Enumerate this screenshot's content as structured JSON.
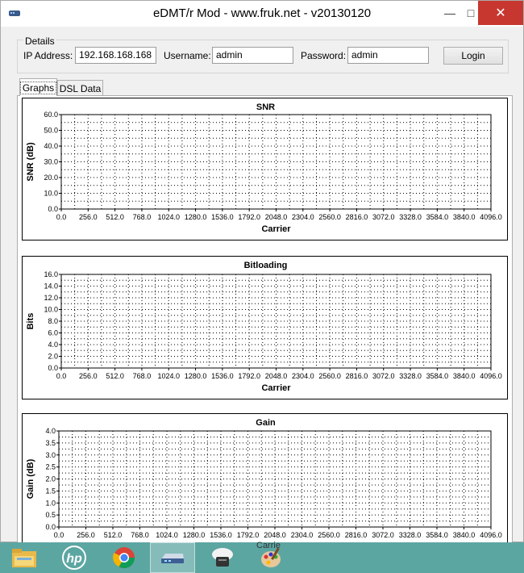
{
  "window": {
    "title": "eDMT/r Mod - www.fruk.net - v20130120",
    "minimize": "—",
    "maximize": "□",
    "close": "✕"
  },
  "details": {
    "legend": "Details",
    "ip_label": "IP Address:",
    "ip_value": "192.168.168.168",
    "username_label": "Username:",
    "username_value": "admin",
    "password_label": "Password:",
    "password_value": "admin",
    "login_label": "Login"
  },
  "tabs": [
    {
      "label": "Graphs",
      "selected": true
    },
    {
      "label": "DSL Data",
      "selected": false
    }
  ],
  "chart_data": [
    {
      "type": "scatter",
      "title": "SNR",
      "xlabel": "Carrier",
      "ylabel": "SNR (dB)",
      "xlim": [
        0,
        4096
      ],
      "ylim": [
        0,
        60
      ],
      "x_ticks": [
        "0.0",
        "256.0",
        "512.0",
        "768.0",
        "1024.0",
        "1280.0",
        "1536.0",
        "1792.0",
        "2048.0",
        "2304.0",
        "2560.0",
        "2816.0",
        "3072.0",
        "3328.0",
        "3584.0",
        "3840.0",
        "4096.0"
      ],
      "y_ticks": [
        "0.0",
        "10.0",
        "20.0",
        "30.0",
        "40.0",
        "50.0",
        "60.0"
      ],
      "grid": true,
      "series": []
    },
    {
      "type": "scatter",
      "title": "Bitloading",
      "xlabel": "Carrier",
      "ylabel": "Bits",
      "xlim": [
        0,
        4096
      ],
      "ylim": [
        0,
        16
      ],
      "x_ticks": [
        "0.0",
        "256.0",
        "512.0",
        "768.0",
        "1024.0",
        "1280.0",
        "1536.0",
        "1792.0",
        "2048.0",
        "2304.0",
        "2560.0",
        "2816.0",
        "3072.0",
        "3328.0",
        "3584.0",
        "3840.0",
        "4096.0"
      ],
      "y_ticks": [
        "0.0",
        "2.0",
        "4.0",
        "6.0",
        "8.0",
        "10.0",
        "12.0",
        "14.0",
        "16.0"
      ],
      "grid": true,
      "series": []
    },
    {
      "type": "scatter",
      "title": "Gain",
      "xlabel": "Carrier",
      "ylabel": "Gain (dB)",
      "xlim": [
        0,
        4096
      ],
      "ylim": [
        0,
        4
      ],
      "x_ticks": [
        "0.0",
        "256.0",
        "512.0",
        "768.0",
        "1024.0",
        "1280.0",
        "1536.0",
        "1792.0",
        "2048.0",
        "2304.0",
        "2560.0",
        "2816.0",
        "3072.0",
        "3328.0",
        "3584.0",
        "3840.0",
        "4096.0"
      ],
      "y_ticks": [
        "0.0",
        "0.5",
        "1.0",
        "1.5",
        "2.0",
        "2.5",
        "3.0",
        "3.5",
        "4.0"
      ],
      "grid": true,
      "series": []
    }
  ],
  "taskbar": {
    "items": [
      {
        "icon": "file-explorer-icon"
      },
      {
        "icon": "hp-icon",
        "text": "hp"
      },
      {
        "icon": "chrome-icon"
      },
      {
        "icon": "network-router-icon",
        "active": true
      },
      {
        "icon": "cloud-drive-icon"
      },
      {
        "icon": "paint-palette-icon"
      }
    ],
    "drag_ghost_text": "Carrie"
  },
  "colors": {
    "close_button": "#c7372f",
    "taskbar": "#5ca6a2",
    "window_bg": "#f0f0f0"
  }
}
